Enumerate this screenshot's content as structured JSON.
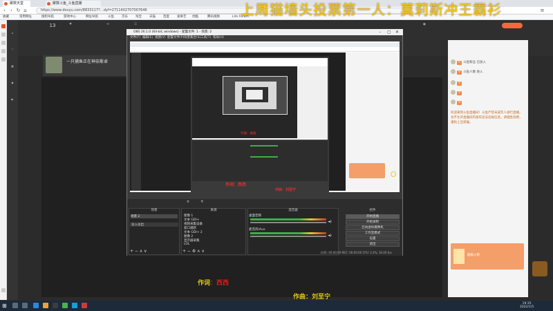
{
  "browser": {
    "tabs": [
      {
        "label": "聚数天堂"
      },
      {
        "label": "聚数斗鱼_斗鱼直播"
      },
      {
        "label": ""
      }
    ],
    "url": "https://www.douyu.com/8833117?…dyf=2711402707007646",
    "bookmarks": [
      "收藏",
      "常用网址",
      "搜狗导航",
      "游戏中心",
      "网址导航",
      "斗鱼",
      "京东",
      "淘宝",
      "天猫",
      "百度",
      "爱奇艺",
      "优酷",
      "腾讯视频",
      "Life Forum"
    ]
  },
  "site": {
    "header_stats": [
      {
        "value": "13",
        "label": ""
      },
      {
        "value": "",
        "label": ""
      },
      {
        "value": "",
        "label": ""
      },
      {
        "value": "",
        "label": ""
      },
      {
        "value": "",
        "label": ""
      }
    ],
    "room_title": "一只捕鱼正在神奈斯卓"
  },
  "overlay": {
    "title": "上周猫墙头投票第一人：莫莉斯冲王霸衫"
  },
  "obs": {
    "window_title": "OBS 26.1.0 (64-bit, windows) - 配置文件: 1 - 场景: 2",
    "menu": [
      "文件(F)",
      "编辑(E)",
      "视图(V)",
      "配置文件(P)",
      "场景集合(S)",
      "工具(T)",
      "帮助(H)"
    ],
    "docks": {
      "scenes_title": "场景",
      "sources_title": "来源",
      "mixer_title": "混音器",
      "transitions_title": "转场特效",
      "controls_title": "控件"
    },
    "sources": [
      "图像 1",
      "文本 GDI+",
      "视频采集设备",
      "窗口捕获",
      "文本 GDI+ 2",
      "图像 2",
      "显示器采集",
      "LOL"
    ],
    "scenes": [
      "场景 2"
    ],
    "transition": "淡入淡出",
    "mixer_channels": [
      "桌面音频",
      "麦克风/Aux"
    ],
    "controls": [
      "开始直播",
      "开始录制",
      "启动虚拟摄像机",
      "工作室模式",
      "设置",
      "退出"
    ],
    "status": "LIVE: 00:00:00  REC: 00:00:00  CPU: 2.4%, 30.00 fps"
  },
  "captions": {
    "nested_small": "作曲：编曲",
    "lyric_prefix": "作词",
    "lyric_name": "：西西",
    "composer": "作曲：刘至宁"
  },
  "chat": {
    "rows": [
      {
        "user": "",
        "text": "斗鱼粉丝 已加入"
      },
      {
        "user": "",
        "text": "斗鱼人数 进入"
      },
      {
        "user": "",
        "text": ""
      },
      {
        "user": "",
        "text": ""
      },
      {
        "user": "",
        "text": ""
      },
      {
        "user": "",
        "text": ""
      }
    ],
    "notice": "欢迎来到斗鱼直播间！斗鱼严禁未成年人进行直播，也不允许直播间内发布违法违规信息。请理性消费，谨防上当受骗。",
    "gift_label": "超级火箭"
  },
  "taskbar": {
    "time": "19:35",
    "date": "2022/1/5"
  },
  "colors": {
    "overlay_gold": "#f5c518",
    "caption_red": "#e82020",
    "chat_accent": "#f08a4b"
  }
}
